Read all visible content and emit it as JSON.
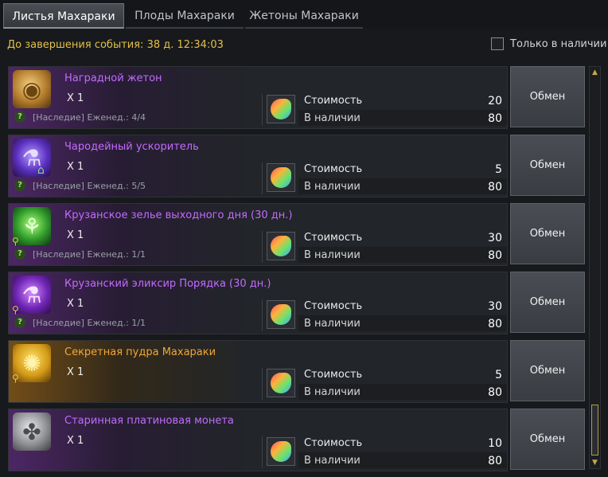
{
  "tabs": [
    {
      "label": "Листья Махараки",
      "active": true
    },
    {
      "label": "Плоды Махараки",
      "active": false
    },
    {
      "label": "Жетоны Махараки",
      "active": false
    }
  ],
  "timer": {
    "text": "До завершения события: 38 д. 12:34:03"
  },
  "filter": {
    "label": "Только в наличии",
    "checked": false
  },
  "labels": {
    "cost": "Стоимость",
    "stock": "В наличии",
    "exchange": "Обмен"
  },
  "items": [
    {
      "name": "Наградной жетон",
      "qty": "X 1",
      "limit": "[Наследие] Еженед.: 4/4",
      "cost": "20",
      "stock": "80",
      "rarity": "purple",
      "icon": "reward-token-icon"
    },
    {
      "name": "Чародейный ускоритель",
      "qty": "X 1",
      "limit": "[Наследие] Еженед.: 5/5",
      "cost": "5",
      "stock": "80",
      "rarity": "purple",
      "icon": "enchant-accelerator-icon"
    },
    {
      "name": "Крузанское зелье выходного дня (30 дн.)",
      "qty": "X 1",
      "limit": "[Наследие] Еженед.: 1/1",
      "cost": "30",
      "stock": "80",
      "rarity": "purple",
      "icon": "weekend-potion-icon"
    },
    {
      "name": "Крузанский эликсир Порядка (30 дн.)",
      "qty": "X 1",
      "limit": "[Наследие] Еженед.: 1/1",
      "cost": "30",
      "stock": "80",
      "rarity": "purple",
      "icon": "order-elixir-icon"
    },
    {
      "name": "Секретная пудра Махараки",
      "qty": "X 1",
      "limit": "",
      "cost": "5",
      "stock": "80",
      "rarity": "orange",
      "icon": "secret-powder-icon"
    },
    {
      "name": "Старинная платиновая монета",
      "qty": "X 1",
      "limit": "",
      "cost": "10",
      "stock": "80",
      "rarity": "purple",
      "icon": "platinum-coin-icon"
    }
  ]
}
